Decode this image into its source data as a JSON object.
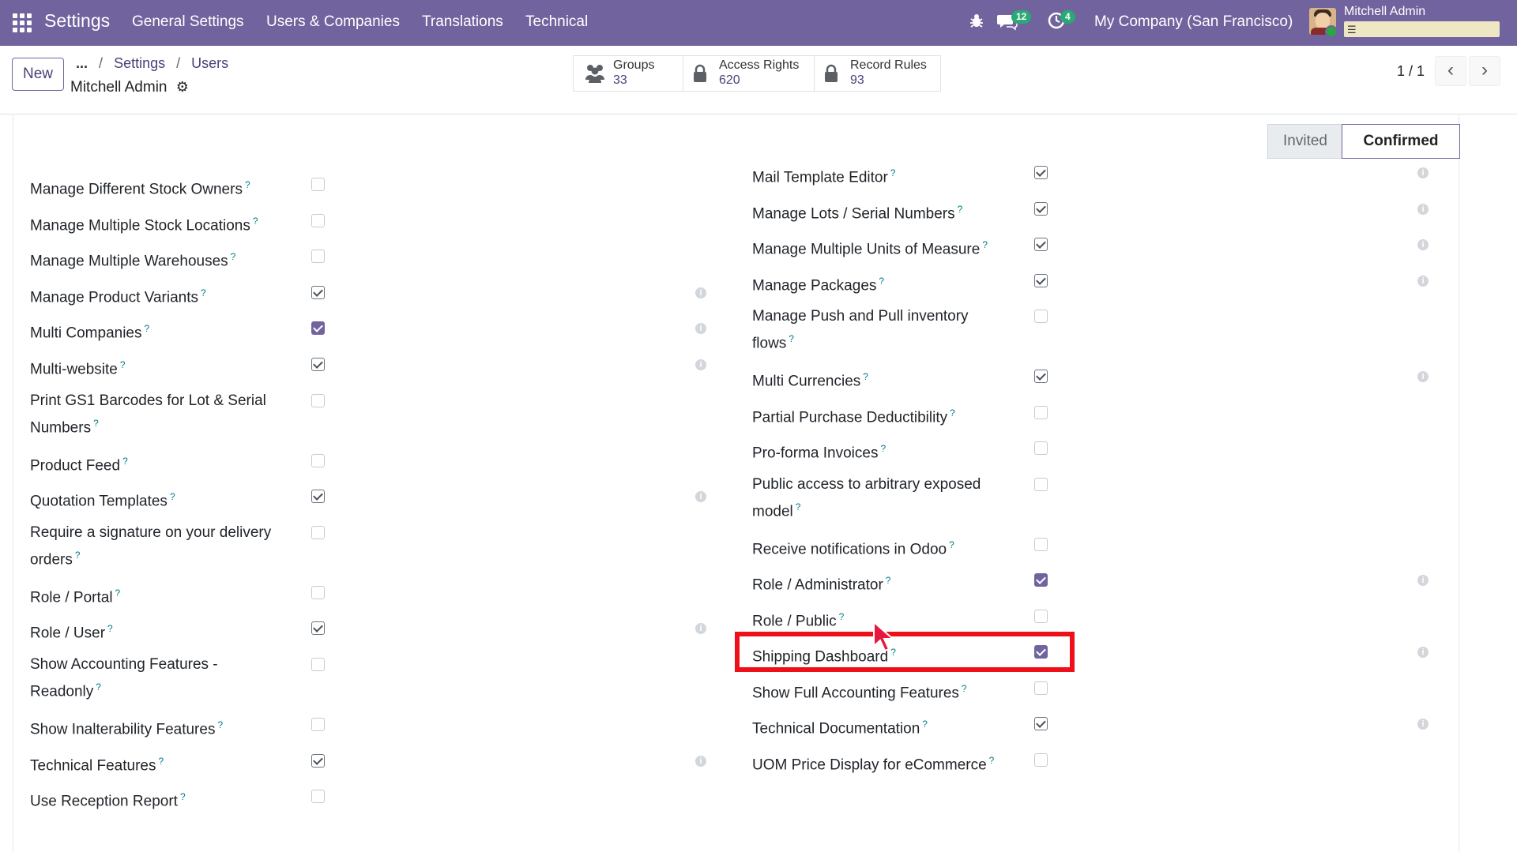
{
  "navbar": {
    "app_name": "Settings",
    "menu": [
      "General Settings",
      "Users & Companies",
      "Translations",
      "Technical"
    ],
    "messages_count": "12",
    "activities_count": "4",
    "company": "My Company (San Francisco)",
    "user": "Mitchell Admin"
  },
  "control_panel": {
    "new_label": "New",
    "breadcrumb": {
      "ellipsis": "...",
      "settings": "Settings",
      "users": "Users",
      "sep": "/"
    },
    "record_title": "Mitchell Admin",
    "smart_buttons": [
      {
        "label": "Groups",
        "count": "33"
      },
      {
        "label": "Access Rights",
        "count": "620"
      },
      {
        "label": "Record Rules",
        "count": "93"
      }
    ],
    "pager": "1 / 1"
  },
  "status": {
    "invited": "Invited",
    "confirmed": "Confirmed"
  },
  "left_column": [
    {
      "label": "Manage Different Stock Owners",
      "checked": false,
      "info": false
    },
    {
      "label": "Manage Multiple Stock Locations",
      "checked": false,
      "info": false
    },
    {
      "label": "Manage Multiple Warehouses",
      "checked": false,
      "info": false
    },
    {
      "label": "Manage Product Variants",
      "checked": true,
      "info": true
    },
    {
      "label": "Multi Companies",
      "checked": true,
      "info": true
    },
    {
      "label": "Multi-website",
      "checked": true,
      "info": true
    },
    {
      "label": "Print GS1 Barcodes for Lot & Serial",
      "label2": "Numbers",
      "checked": false,
      "info": false
    },
    {
      "label": "Product Feed",
      "checked": false,
      "info": false
    },
    {
      "label": "Quotation Templates",
      "checked": true,
      "info": true
    },
    {
      "label": "Require a signature on your delivery",
      "label2": "orders",
      "checked": false,
      "info": false
    },
    {
      "label": "Role / Portal",
      "checked": false,
      "info": false
    },
    {
      "label": "Role / User",
      "checked": true,
      "info": true
    },
    {
      "label": "Show Accounting Features -",
      "label2": "Readonly",
      "checked": false,
      "info": false
    },
    {
      "label": "Show Inalterability Features",
      "checked": false,
      "info": false
    },
    {
      "label": "Technical Features",
      "checked": true,
      "info": true
    },
    {
      "label": "Use Reception Report",
      "checked": false,
      "info": false
    }
  ],
  "right_column": [
    {
      "label": "Mail Template Editor",
      "checked": true,
      "info": true
    },
    {
      "label": "Manage Lots / Serial Numbers",
      "checked": true,
      "info": true
    },
    {
      "label": "Manage Multiple Units of Measure",
      "checked": true,
      "info": true
    },
    {
      "label": "Manage Packages",
      "checked": true,
      "info": true
    },
    {
      "label": "Manage Push and Pull inventory",
      "label2": "flows",
      "checked": false,
      "info": false
    },
    {
      "label": "Multi Currencies",
      "checked": true,
      "info": true
    },
    {
      "label": "Partial Purchase Deductibility",
      "checked": false,
      "info": false
    },
    {
      "label": "Pro-forma Invoices",
      "checked": false,
      "info": false
    },
    {
      "label": "Public access to arbitrary exposed",
      "label2": "model",
      "checked": false,
      "info": false
    },
    {
      "label": "Receive notifications in Odoo",
      "checked": false,
      "info": false
    },
    {
      "label": "Role / Administrator",
      "checked": true,
      "info": true
    },
    {
      "label": "Role / Public",
      "checked": false,
      "info": false
    },
    {
      "label": "Shipping Dashboard",
      "checked": true,
      "info": true
    },
    {
      "label": "Show Full Accounting Features",
      "checked": false,
      "info": false
    },
    {
      "label": "Technical Documentation",
      "checked": true,
      "info": true
    },
    {
      "label": "UOM Price Display for eCommerce",
      "checked": false,
      "info": false
    }
  ],
  "help_mark": "?",
  "info_mark": "i",
  "colors": {
    "brand": "#71639e",
    "highlight": "#ee0f18",
    "badge": "#2aa876"
  }
}
